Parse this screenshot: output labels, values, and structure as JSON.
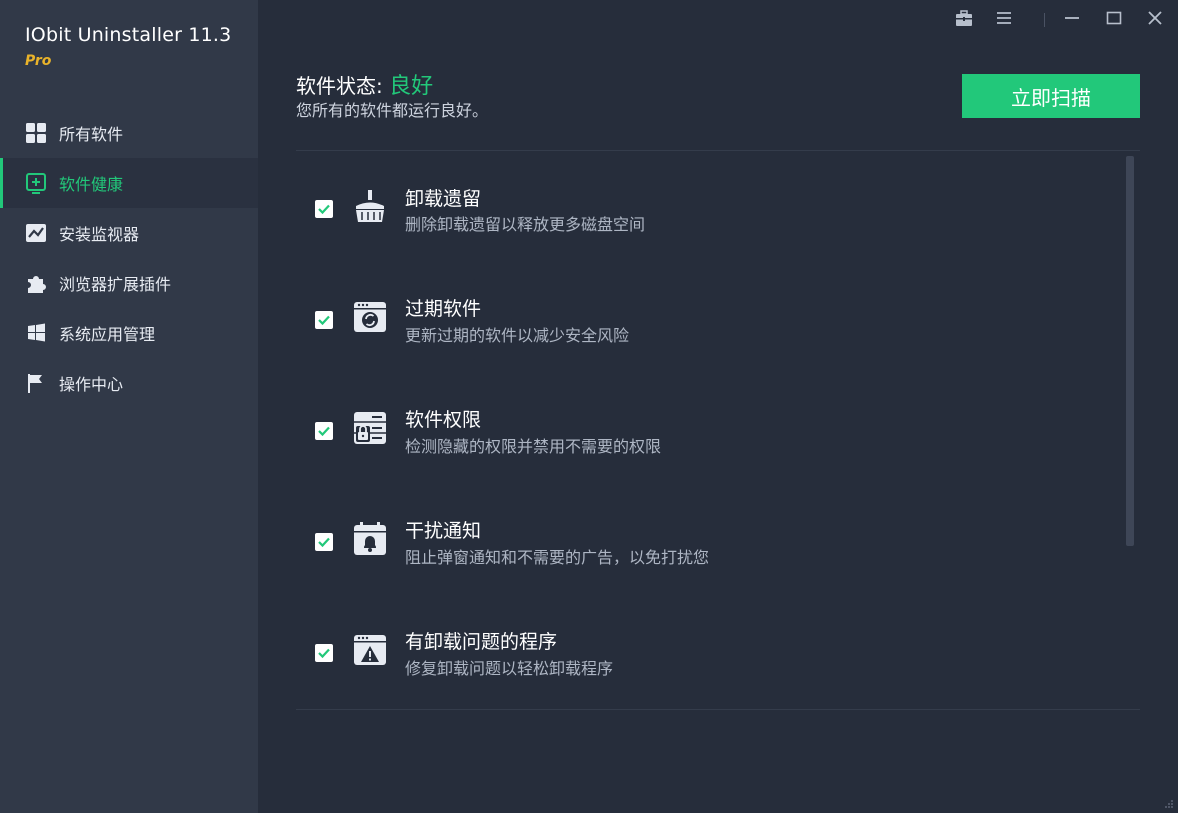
{
  "app": {
    "title": "IObit Uninstaller 11.3",
    "edition": "Pro"
  },
  "sidebar": {
    "items": [
      {
        "label": "所有软件",
        "icon": "grid-icon",
        "active": false
      },
      {
        "label": "软件健康",
        "icon": "health-plus-icon",
        "active": true
      },
      {
        "label": "安装监视器",
        "icon": "monitor-chart-icon",
        "active": false
      },
      {
        "label": "浏览器扩展插件",
        "icon": "puzzle-icon",
        "active": false
      },
      {
        "label": "系统应用管理",
        "icon": "windows-icon",
        "active": false
      },
      {
        "label": "操作中心",
        "icon": "flag-icon",
        "active": false
      }
    ]
  },
  "header": {
    "status_label": "软件状态:",
    "status_value": "良好",
    "status_desc": "您所有的软件都运行良好。",
    "scan_button": "立即扫描"
  },
  "items": [
    {
      "title": "卸载遗留",
      "desc": "删除卸载遗留以释放更多磁盘空间",
      "icon": "broom-icon",
      "checked": true
    },
    {
      "title": "过期软件",
      "desc": "更新过期的软件以减少安全风险",
      "icon": "update-window-icon",
      "checked": true
    },
    {
      "title": "软件权限",
      "desc": "检测隐藏的权限并禁用不需要的权限",
      "icon": "permission-lock-icon",
      "checked": true
    },
    {
      "title": "干扰通知",
      "desc": "阻止弹窗通知和不需要的广告，以免打扰您",
      "icon": "notification-bell-icon",
      "checked": true
    },
    {
      "title": "有卸载问题的程序",
      "desc": "修复卸载问题以轻松卸载程序",
      "icon": "warning-window-icon",
      "checked": true
    }
  ],
  "colors": {
    "accent": "#22c87a",
    "sidebar_bg": "#313948",
    "main_bg": "#262d3b",
    "edition": "#e9b32a"
  }
}
